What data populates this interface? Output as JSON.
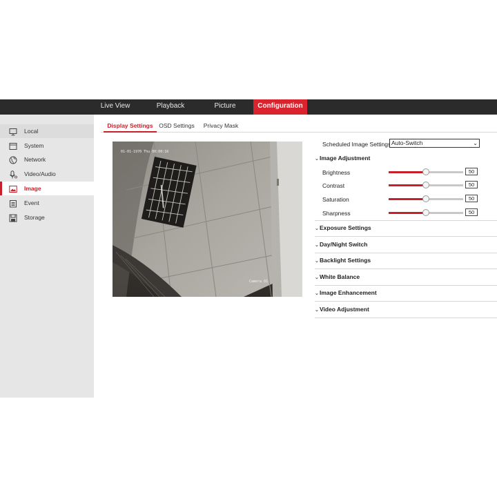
{
  "topnav": {
    "items": [
      {
        "label": "Live View"
      },
      {
        "label": "Playback"
      },
      {
        "label": "Picture"
      },
      {
        "label": "Configuration",
        "active": true
      }
    ]
  },
  "sidebar": {
    "items": [
      {
        "label": "Local",
        "icon": "monitor-icon"
      },
      {
        "label": "System",
        "icon": "window-icon"
      },
      {
        "label": "Network",
        "icon": "globe-icon"
      },
      {
        "label": "Video/Audio",
        "icon": "microphone-icon"
      },
      {
        "label": "Image",
        "icon": "image-icon",
        "active": true
      },
      {
        "label": "Event",
        "icon": "calendar-icon"
      },
      {
        "label": "Storage",
        "icon": "disk-icon"
      }
    ]
  },
  "tabs": [
    {
      "label": "Display Settings",
      "active": true
    },
    {
      "label": "OSD Settings"
    },
    {
      "label": "Privacy Mask"
    }
  ],
  "preview": {
    "timestamp": "01-01-1970 Thu 00:00:16",
    "camera_name": "Camera 01"
  },
  "scheduled": {
    "label": "Scheduled Image Settings",
    "value": "Auto-Switch"
  },
  "image_adjustment": {
    "title": "Image Adjustment",
    "sliders": [
      {
        "label": "Brightness",
        "value": 50
      },
      {
        "label": "Contrast",
        "value": 50
      },
      {
        "label": "Saturation",
        "value": 50
      },
      {
        "label": "Sharpness",
        "value": 50
      }
    ]
  },
  "sections": [
    {
      "label": "Exposure Settings"
    },
    {
      "label": "Day/Night Switch"
    },
    {
      "label": "Backlight Settings"
    },
    {
      "label": "White Balance"
    },
    {
      "label": "Image Enhancement"
    },
    {
      "label": "Video Adjustment"
    }
  ],
  "colors": {
    "accent": "#d9232d",
    "topbar": "#2b2b2b",
    "sidebar": "#e6e6e6"
  }
}
